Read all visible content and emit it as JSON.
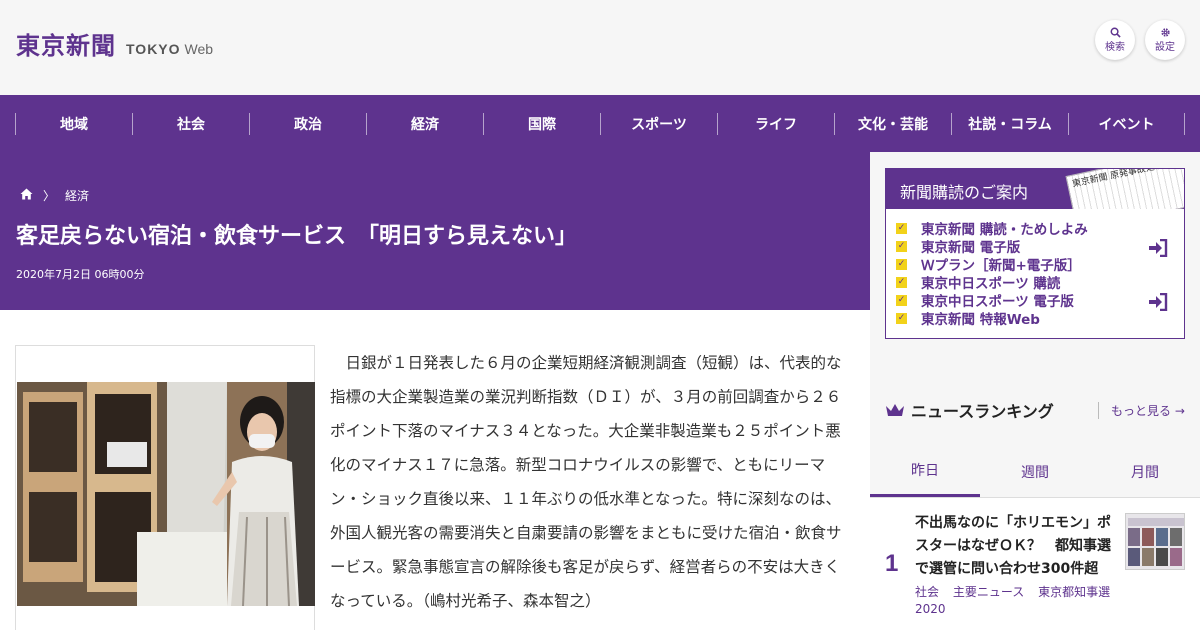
{
  "header": {
    "logo_jp": "東京新聞",
    "logo_en": "TOKYO",
    "logo_web": "Web",
    "search_label": "検索",
    "settings_label": "設定"
  },
  "nav": {
    "items": [
      "地域",
      "社会",
      "政治",
      "経済",
      "国際",
      "スポーツ",
      "ライフ",
      "文化・芸能",
      "社説・コラム",
      "イベント"
    ]
  },
  "article": {
    "breadcrumb": "経済",
    "title": "客足戻らない宿泊・飲食サービス　「明日すら見えない」",
    "date": "2020年7月2日 06時00分",
    "body": "日銀が１日発表した６月の企業短期経済観測調査（短観）は、代表的な指標の大企業製造業の業況判断指数（ＤＩ）が、３月の前回調査から２６ポイント下落のマイナス３４となった。大企業非製造業も２５ポイント悪化のマイナス１７に急落。新型コロナウイルスの影響で、ともにリーマン・ショック直後以来、１１年ぶりの低水準となった。特に深刻なのは、外国人観光客の需要消失と自粛要請の影響をまともに受けた宿泊・飲食サービス。緊急事態宣言の解除後も客足が戻らず、経営者らの不安は大きくなっている。（嶋村光希子、森本智之）"
  },
  "promo": {
    "title": "新聞購読のご案内",
    "paper_text": "東京新聞 原発事故処理に",
    "items": [
      "東京新聞 購読・ためしよみ",
      "東京新聞 電子版",
      "Ｗプラン［新聞+電子版］",
      "東京中日スポーツ 購読",
      "東京中日スポーツ 電子版",
      "東京新聞 特報Web"
    ]
  },
  "ranking": {
    "title": "ニュースランキング",
    "more": "もっと見る",
    "tabs": [
      "昨日",
      "週間",
      "月間"
    ],
    "item1": {
      "rank": "1",
      "title": "不出馬なのに「ホリエモン」ポスターはなぜＯＫ？　都知事選で選管に問い合わせ300件超",
      "tags": [
        "社会",
        "主要ニュース",
        "東京都知事選2020"
      ]
    }
  },
  "colors": {
    "brand": "#5e338e",
    "check": "#f2d21a"
  }
}
